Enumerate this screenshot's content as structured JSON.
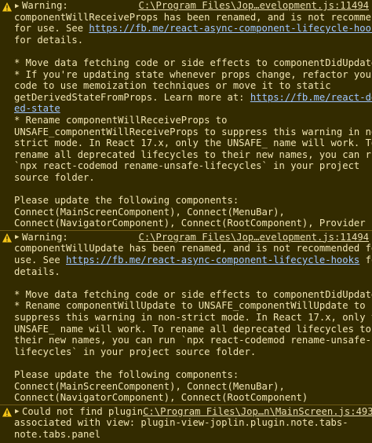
{
  "messages": [
    {
      "label": "Warning:",
      "source": "C:\\Program Files\\Jop…evelopment.js:11494",
      "lines": [
        "componentWillReceiveProps has been renamed, and is not recommended",
        "for use. See ",
        "for details.",
        "",
        "* Move data fetching code or side effects to componentDidUpdate.",
        "* If you're updating state whenever props change, refactor your",
        "code to use memoization techniques or move it to static",
        "getDerivedStateFromProps. Learn more at: ",
        "* Rename componentWillReceiveProps to",
        "UNSAFE_componentWillReceiveProps to suppress this warning in non-",
        "strict mode. In React 17.x, only the UNSAFE_ name will work. To",
        "rename all deprecated lifecycles to their new names, you can run",
        "`npx react-codemod rename-unsafe-lifecycles` in your project",
        "source folder.",
        "",
        "Please update the following components:",
        "Connect(MainScreenComponent), Connect(MenuBar),",
        "Connect(NavigatorComponent), Connect(RootComponent), Provider"
      ],
      "link_async": "https://fb.me/react-async-component-lifecycle-hooks",
      "link_derived_a": "https://fb.me/react-deriv",
      "link_derived_b": "ed-state"
    },
    {
      "label": "Warning:",
      "source": "C:\\Program Files\\Jop…evelopment.js:11494",
      "lines": [
        "componentWillUpdate has been renamed, and is not recommended for",
        "use. See ",
        "details.",
        "",
        "* Move data fetching code or side effects to componentDidUpdate.",
        "* Rename componentWillUpdate to UNSAFE_componentWillUpdate to",
        "suppress this warning in non-strict mode. In React 17.x, only the",
        "UNSAFE_ name will work. To rename all deprecated lifecycles to",
        "their new names, you can run `npx react-codemod rename-unsafe-",
        "lifecycles` in your project source folder.",
        "",
        "Please update the following components:",
        "Connect(MainScreenComponent), Connect(MenuBar),",
        "Connect(NavigatorComponent), Connect(RootComponent)"
      ],
      "link_async": "https://fb.me/react-async-component-lifecycle-hooks",
      "link_suffix": " for"
    },
    {
      "label": "Could not find plugin",
      "source": "C:\\Program Files\\Jop…n\\MainScreen.js:493",
      "lines": [
        "associated with view: plugin-view-joplin.plugin.note.tabs-",
        "note.tabs.panel"
      ]
    }
  ],
  "colors": {
    "background": "#332b00",
    "border": "#6e5a14",
    "text": "#f0e4b2",
    "link": "#9fc6ff",
    "warning_icon": "#f5c518"
  },
  "icons": {
    "warning": "warning-triangle-icon",
    "toggle": "expand-triangle-icon"
  }
}
